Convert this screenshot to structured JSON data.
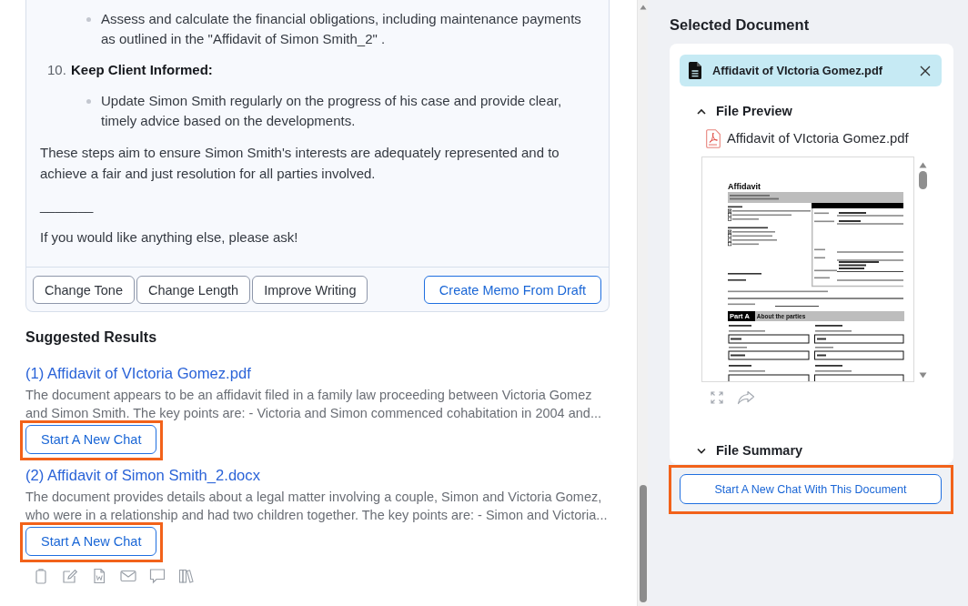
{
  "chat_message": {
    "bullets": [
      "Assess and calculate the financial obligations, including maintenance payments as outlined in the \"Affidavit of Simon Smith_2\" ."
    ],
    "numbered_items": [
      {
        "number": "10.",
        "title": "Keep Client Informed:",
        "bullets": [
          "Update Simon Smith regularly on the progress of his case and provide clear, timely advice based on the developments."
        ]
      }
    ],
    "paragraphs": [
      "These steps aim to ensure Simon Smith's interests are adequately represented and to achieve a fair and just resolution for all parties involved.",
      "_______",
      "If you would like anything else, please ask!"
    ],
    "actions": [
      {
        "label": "Change Tone",
        "kind": "outline"
      },
      {
        "label": "Change Length",
        "kind": "outline"
      },
      {
        "label": "Improve Writing",
        "kind": "outline"
      },
      {
        "label": "Create Memo From Draft",
        "kind": "primary"
      }
    ]
  },
  "suggested_results": {
    "title": "Suggested Results",
    "items": [
      {
        "title": "(1) Affidavit of VIctoria Gomez.pdf",
        "description": "The document appears to be an affidavit filed in a family law proceeding between Victoria Gomez and Simon Smith. The key points are: - Victoria and Simon commenced cohabitation in 2004 and...",
        "button": "Start A New Chat",
        "highlighted": true
      },
      {
        "title": "(2) Affidavit of Simon Smith_2.docx",
        "description": "The document provides details about a legal matter involving a couple, Simon and Victoria Gomez, who were in a relationship and had two children together. The key points are: - Simon and Victoria...",
        "button": "Start A New Chat",
        "highlighted": true
      }
    ]
  },
  "selected_document": {
    "title": "Selected Document",
    "chip": {
      "file_name": "Affidavit of VIctoria Gomez.pdf"
    },
    "file_preview": {
      "label": "File Preview",
      "expanded": true,
      "file_name": "Affidavit of VIctoria Gomez.pdf",
      "page": {
        "title": "Affidavit",
        "part": {
          "number": "Part A",
          "title": "About the parties"
        }
      }
    },
    "file_summary": {
      "label": "File Summary",
      "expanded": false
    },
    "button": {
      "label": "Start A New Chat With This Document",
      "highlighted": true
    }
  }
}
